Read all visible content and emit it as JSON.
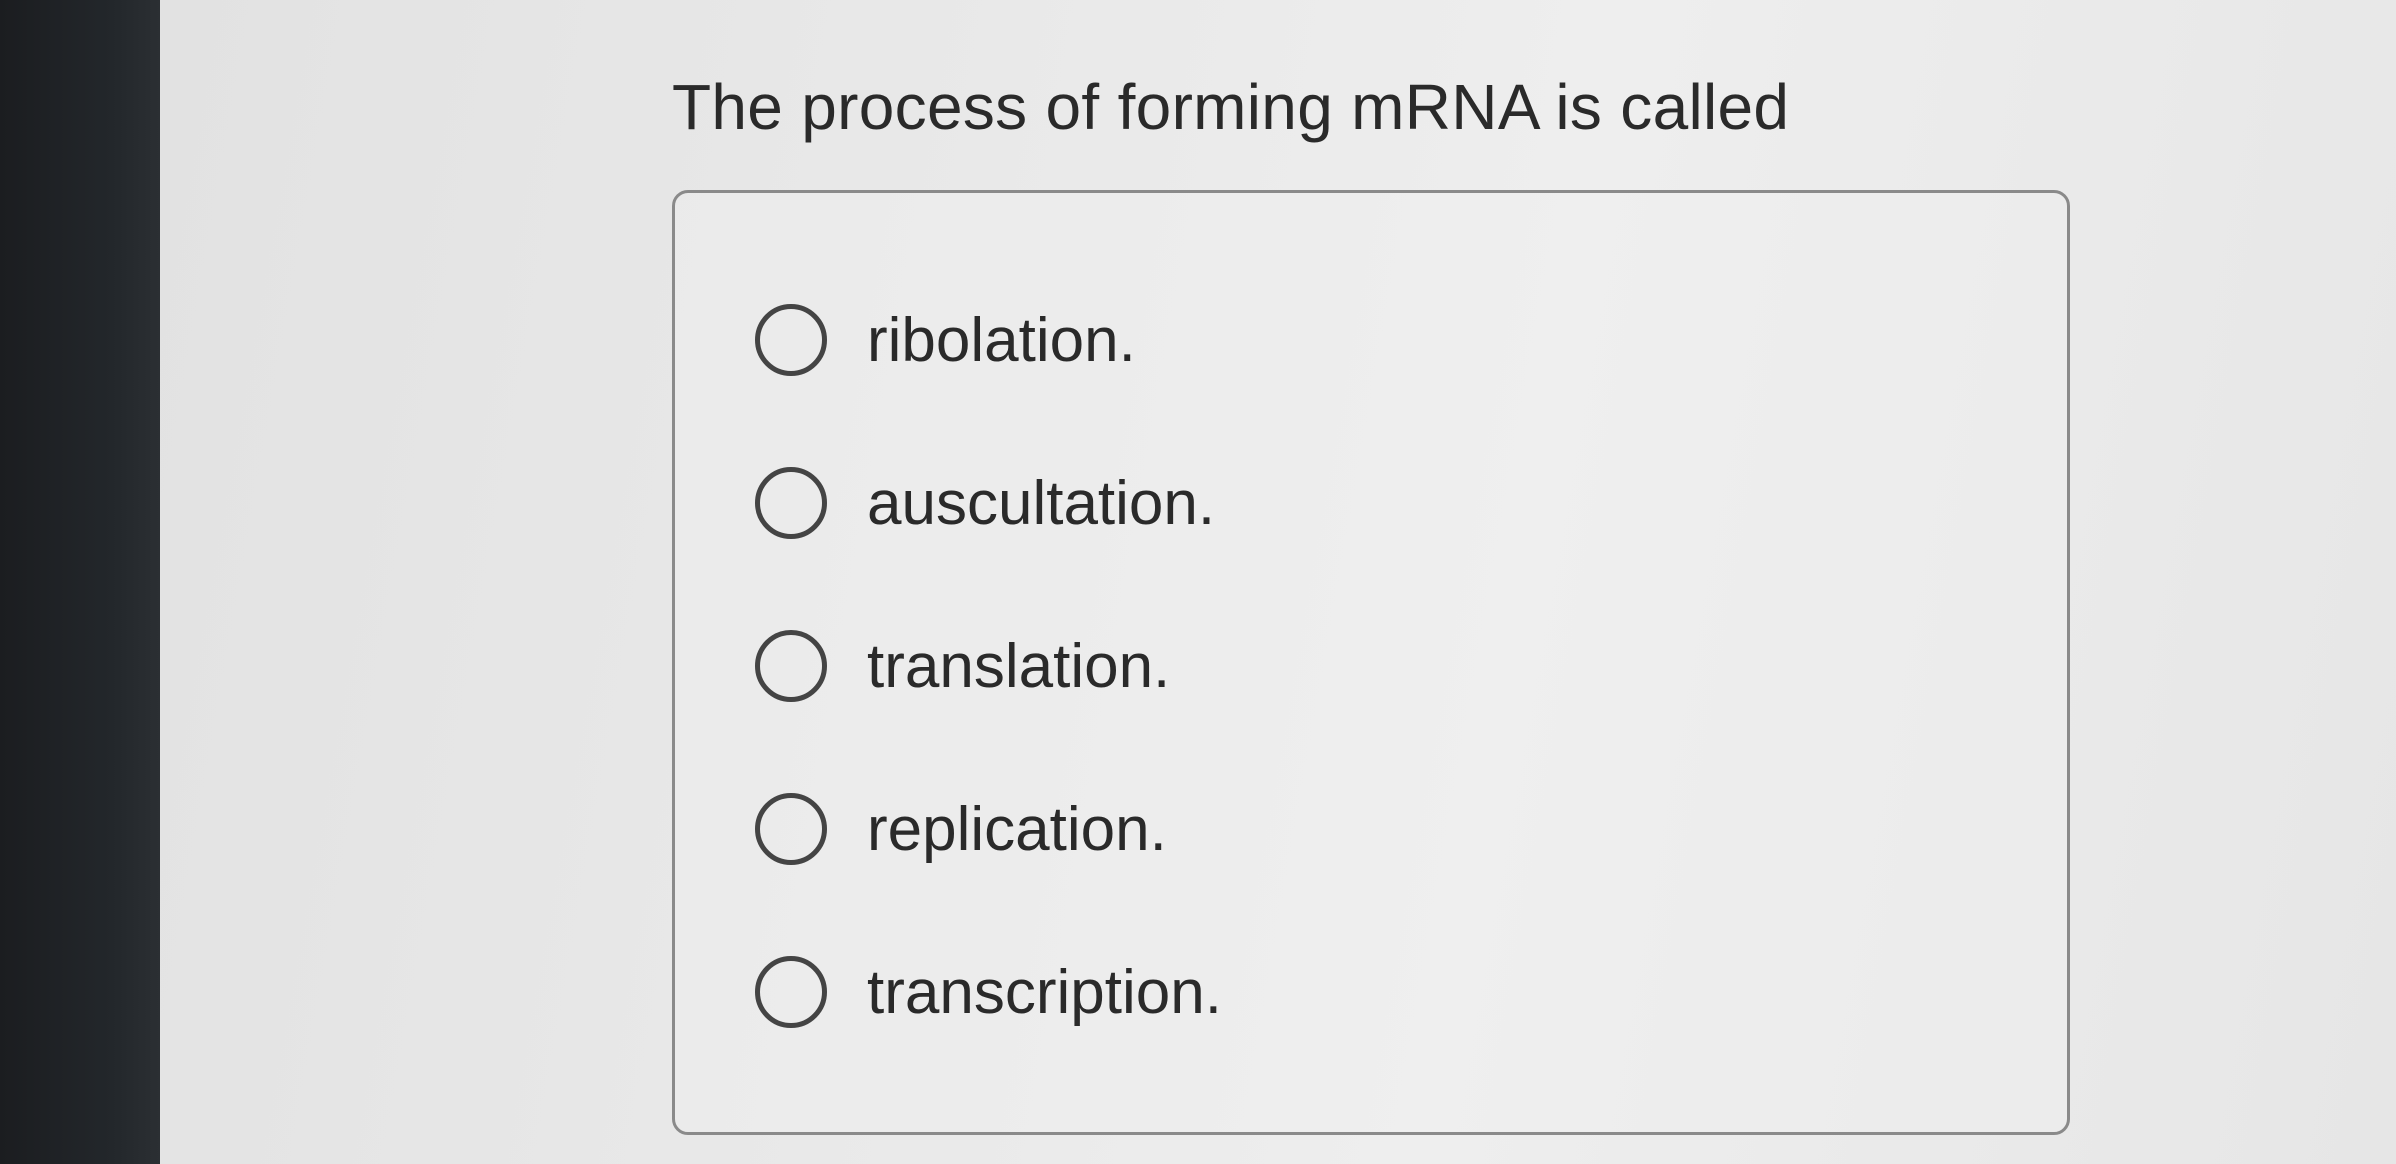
{
  "question": {
    "text": "The process of forming mRNA is called"
  },
  "options": [
    {
      "label": "ribolation.",
      "selected": false,
      "icon": "radio-circle"
    },
    {
      "label": "auscultation.",
      "selected": false,
      "icon": "radio-circle"
    },
    {
      "label": "translation.",
      "selected": false,
      "icon": "radio-circle"
    },
    {
      "label": "replication.",
      "selected": false,
      "icon": "radio-circle"
    },
    {
      "label": "transcription.",
      "selected": false,
      "icon": "radio-circle"
    }
  ]
}
